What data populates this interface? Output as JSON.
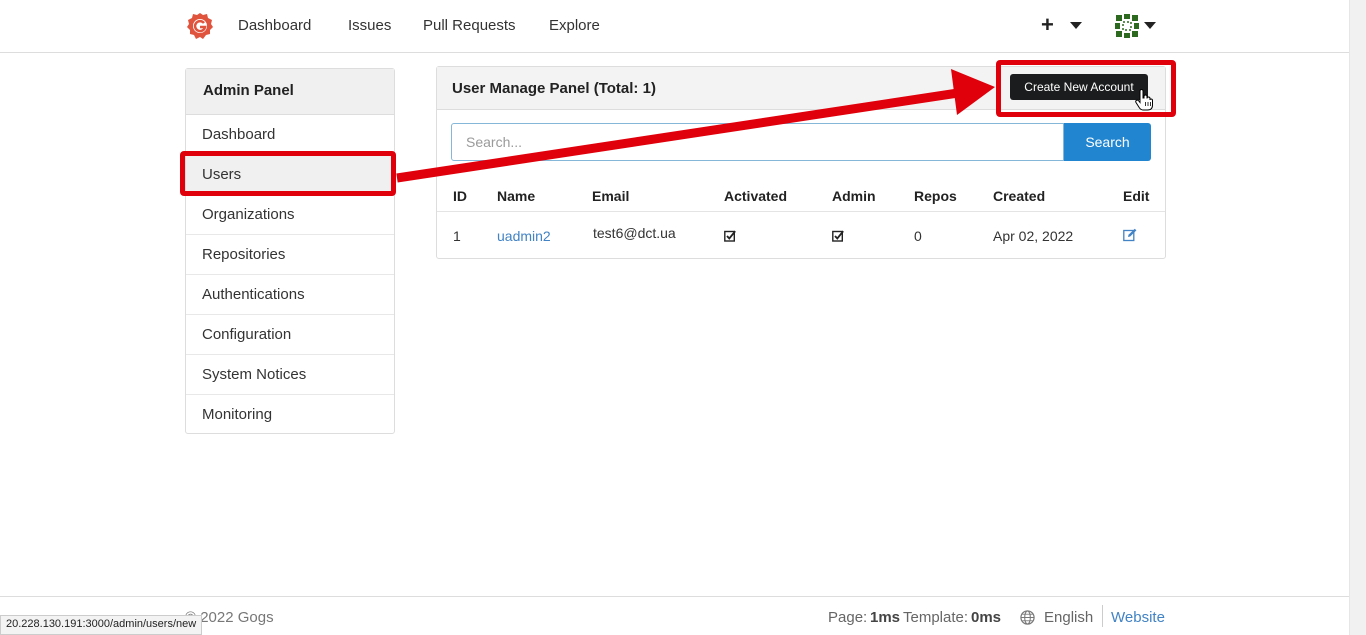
{
  "nav": {
    "links": [
      "Dashboard",
      "Issues",
      "Pull Requests",
      "Explore"
    ],
    "plus_label": "+"
  },
  "sidebar": {
    "title": "Admin Panel",
    "items": [
      "Dashboard",
      "Users",
      "Organizations",
      "Repositories",
      "Authentications",
      "Configuration",
      "System Notices",
      "Monitoring"
    ],
    "active": "Users"
  },
  "panel": {
    "title": "User Manage Panel (Total: 1)",
    "create_label": "Create New Account",
    "search_placeholder": "Search...",
    "search_button": "Search"
  },
  "table": {
    "headers": [
      "ID",
      "Name",
      "Email",
      "Activated",
      "Admin",
      "Repos",
      "Created",
      "Edit"
    ],
    "rows": [
      {
        "id": "1",
        "name": "uadmin2",
        "email": "test6@dct.ua",
        "activated": true,
        "admin": true,
        "repos": "0",
        "created": "Apr 02, 2022"
      }
    ]
  },
  "footer": {
    "copyright": "© 2022 Gogs",
    "page_label": "Page:",
    "page_time": "1ms",
    "template_label": "Template:",
    "template_time": "0ms",
    "language": "English",
    "website": "Website"
  },
  "status_url": "20.228.130.191:3000/admin/users/new",
  "colors": {
    "brand": "#e0533d",
    "primary_button": "#2185d0",
    "link": "#4183c4",
    "annotation": "#e0000b"
  }
}
